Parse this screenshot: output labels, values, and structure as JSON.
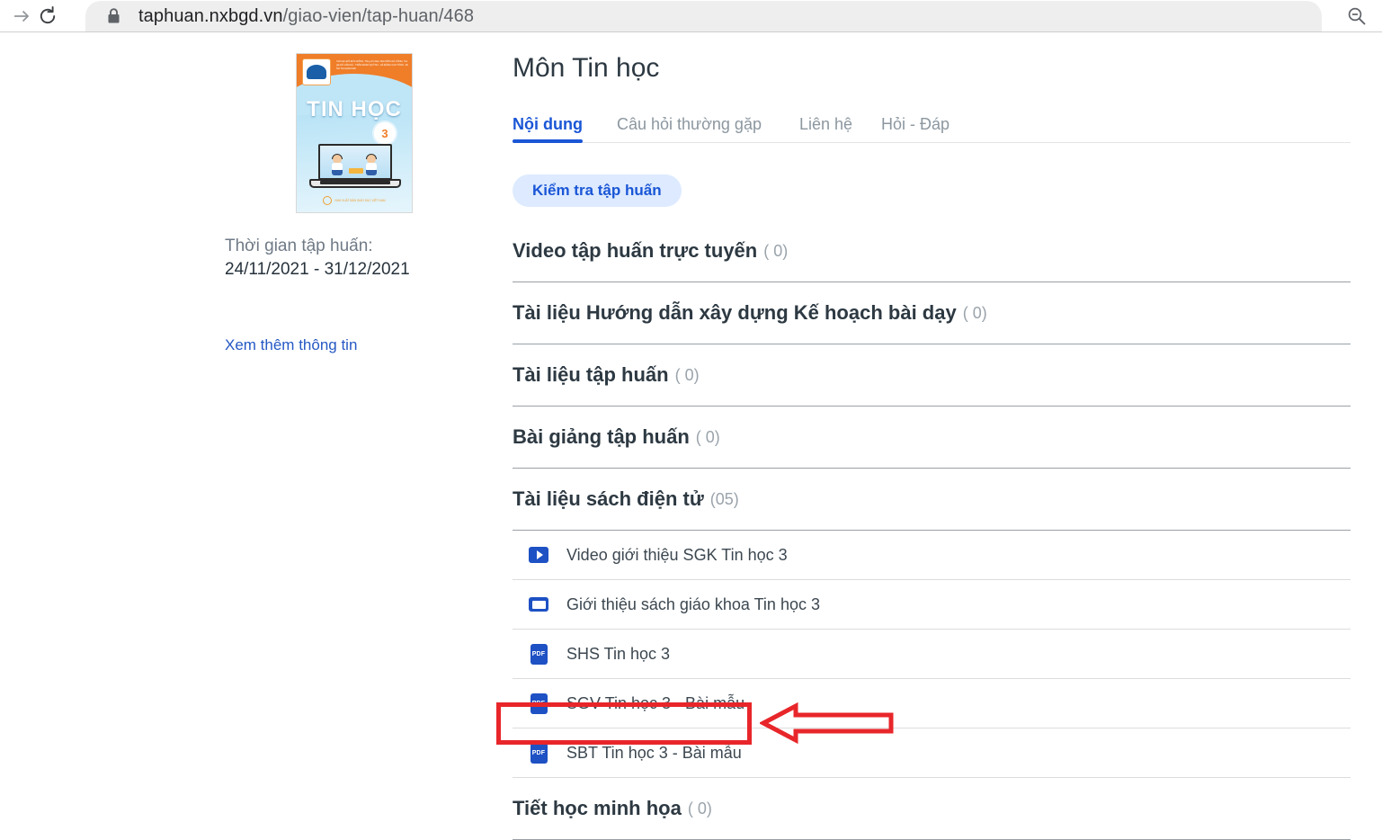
{
  "browser": {
    "forward_icon": "arrow-right-icon",
    "reload_icon": "reload-icon",
    "lock_icon": "lock-icon",
    "zoom_out_icon": "zoom-out-icon",
    "url_domain": "taphuan.nxbgd.vn",
    "url_path": "/giao-vien/tap-huan/468"
  },
  "book": {
    "cover_publisher_lines": "Chủ biên ĐỖ ĐỨC ĐÔNG; Tổng chủ biên NGUYỄN CHÍ CÔNG; Tác giả HỒ CẨM HÀ - TRẦN ĐOAN QUỲNH - HÀ ĐẶNG CAO TÙNG - ĐINH THỊ HẠNH MAI",
    "cover_title": "TIN HỌC",
    "cover_grade": "3",
    "cover_footer": "NHÀ XUẤT BẢN GIÁO DỤC VIỆT NAM",
    "training_period_label": "Thời gian tập huấn:",
    "training_period_value": "24/11/2021 - 31/12/2021",
    "more_info_link": "Xem thêm thông tin"
  },
  "main": {
    "title": "Môn Tin học",
    "tabs": [
      {
        "label": "Nội dung",
        "active": true
      },
      {
        "label": "Câu hỏi thường gặp",
        "active": false
      },
      {
        "label": "Liên hệ",
        "active": false
      },
      {
        "label": "Hỏi - Đáp",
        "active": false
      }
    ],
    "badge": "Kiểm tra tập huấn",
    "sections": [
      {
        "title": "Video tập huấn trực tuyến",
        "count": "( 0)",
        "items": []
      },
      {
        "title": "Tài liệu Hướng dẫn xây dựng Kế hoạch bài dạy",
        "count": "( 0)",
        "items": []
      },
      {
        "title": "Tài liệu tập huấn",
        "count": "( 0)",
        "items": []
      },
      {
        "title": "Bài giảng tập huấn",
        "count": "( 0)",
        "items": []
      },
      {
        "title": "Tài liệu sách điện tử",
        "count": "(05)",
        "items": [
          {
            "icon": "video-icon",
            "icon_type": "video",
            "label": "Video giới thiệu SGK Tin học 3"
          },
          {
            "icon": "slide-icon",
            "icon_type": "slide",
            "label": "Giới thiệu sách giáo khoa Tin học 3"
          },
          {
            "icon": "pdf-icon",
            "icon_type": "pdf",
            "label": "SHS Tin học 3"
          },
          {
            "icon": "pdf-icon",
            "icon_type": "pdf",
            "label": "SGV Tin học 3 - Bài mẫu"
          },
          {
            "icon": "pdf-icon",
            "icon_type": "pdf",
            "label": "SBT Tin học 3 - Bài mẫu"
          }
        ]
      },
      {
        "title": "Tiết học minh họa",
        "count": "( 0)",
        "items": []
      }
    ]
  },
  "annotation": {
    "highlight_target": "SGV Tin học 3 - Bài mẫu",
    "color": "#e8262a",
    "arrow_direction": "left"
  },
  "colors": {
    "accent_blue": "#1a56d6",
    "icon_blue": "#1d51c4",
    "badge_bg": "#ddeaff",
    "annotation_red": "#e8262a",
    "text_dark": "#2d3942",
    "text_muted": "#9aa3ab"
  },
  "icon_glyphs": {
    "pdf_label": "PDF"
  }
}
